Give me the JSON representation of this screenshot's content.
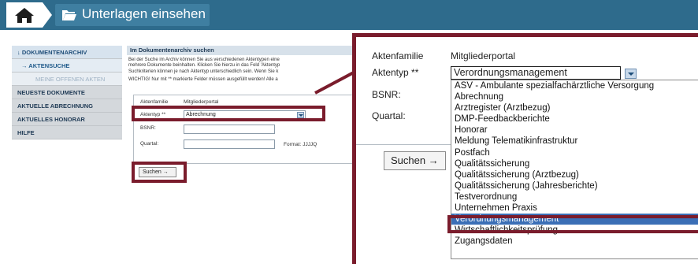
{
  "header": {
    "title": "Unterlagen einsehen",
    "home_icon": "home-icon",
    "folder_icon": "folder-open-icon",
    "bar_color": "#2e6b8c"
  },
  "sidebar": {
    "items": [
      {
        "label": "↓ DOKUMENTENARCHIV"
      },
      {
        "label": "→ AKTENSUCHE"
      },
      {
        "label": "MEINE OFFENEN AKTEN"
      },
      {
        "label": "NEUESTE DOKUMENTE"
      },
      {
        "label": "AKTUELLE ABRECHNUNG"
      },
      {
        "label": "AKTUELLES HONORAR"
      },
      {
        "label": "HILFE"
      }
    ]
  },
  "search": {
    "heading": "Im Dokumentenarchiv suchen",
    "description_lines": [
      "Bei der Suche im Archiv können Sie aus verschiedenen Aktentypen eine",
      "mehrere Dokumente beinhalten. Klicken Sie hierzu in das Feld 'Aktentyp",
      "Suchkriterien können je nach Aktentyp unterschiedlich sein. Wenn Sie k"
    ],
    "warning": "WICHTIG! Nur mit ** markierte Felder müssen ausgefüllt werden! Alle a",
    "aktenfamilie_label": "Aktenfamilie",
    "aktenfamilie_value": "Mitgliederportal",
    "aktentyp_label": "Aktentyp **",
    "aktentyp_value": "Abrechnung",
    "bsnr_label": "BSNR:",
    "quartal_label": "Quartal:",
    "format_label": "Format: JJJJQ",
    "submit_label": "Suchen →"
  },
  "zoom": {
    "aktenfamilie_label": "Aktenfamilie",
    "aktenfamilie_value": "Mitgliederportal",
    "aktentyp_label": "Aktentyp **",
    "aktentyp_value": "Verordnungsmanagement",
    "bsnr_label": "BSNR:",
    "quartal_label": "Quartal:",
    "submit_label": "Suchen →",
    "options": [
      "ASV - Ambulante spezialfachärztliche Versorgung",
      "Abrechnung",
      "Arztregister (Arztbezug)",
      "DMP-Feedbackberichte",
      "Honorar",
      "Meldung Telematikinfrastruktur",
      "Postfach",
      "Qualitätssicherung",
      "Qualitätssicherung (Arztbezug)",
      "Qualitätssicherung (Jahresberichte)",
      "Testverordnung",
      "Unternehmen Praxis",
      "Verordnungsmanagement",
      "Wirtschaftlichkeitsprüfung",
      "Zugangsdaten"
    ],
    "selected_index": 12,
    "highlight_color": "#7a1c2c"
  }
}
